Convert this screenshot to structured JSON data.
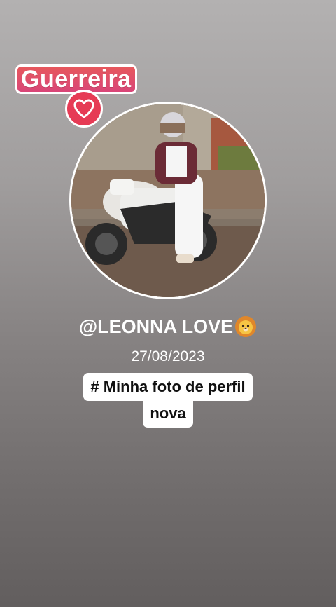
{
  "sticker": {
    "text": "Guerreira",
    "icon": "heart-icon"
  },
  "profile": {
    "avatar_icon": "profile-photo",
    "username": "@LEONNA LOVE",
    "username_emoji": "lion-face-emoji",
    "date": "27/08/2023"
  },
  "caption": {
    "line1": "# Minha foto de perfil",
    "line2": "nova"
  },
  "colors": {
    "sticker_bg": "#e04f66",
    "heart_bg": "#e63b55",
    "caption_bg": "#ffffff"
  }
}
